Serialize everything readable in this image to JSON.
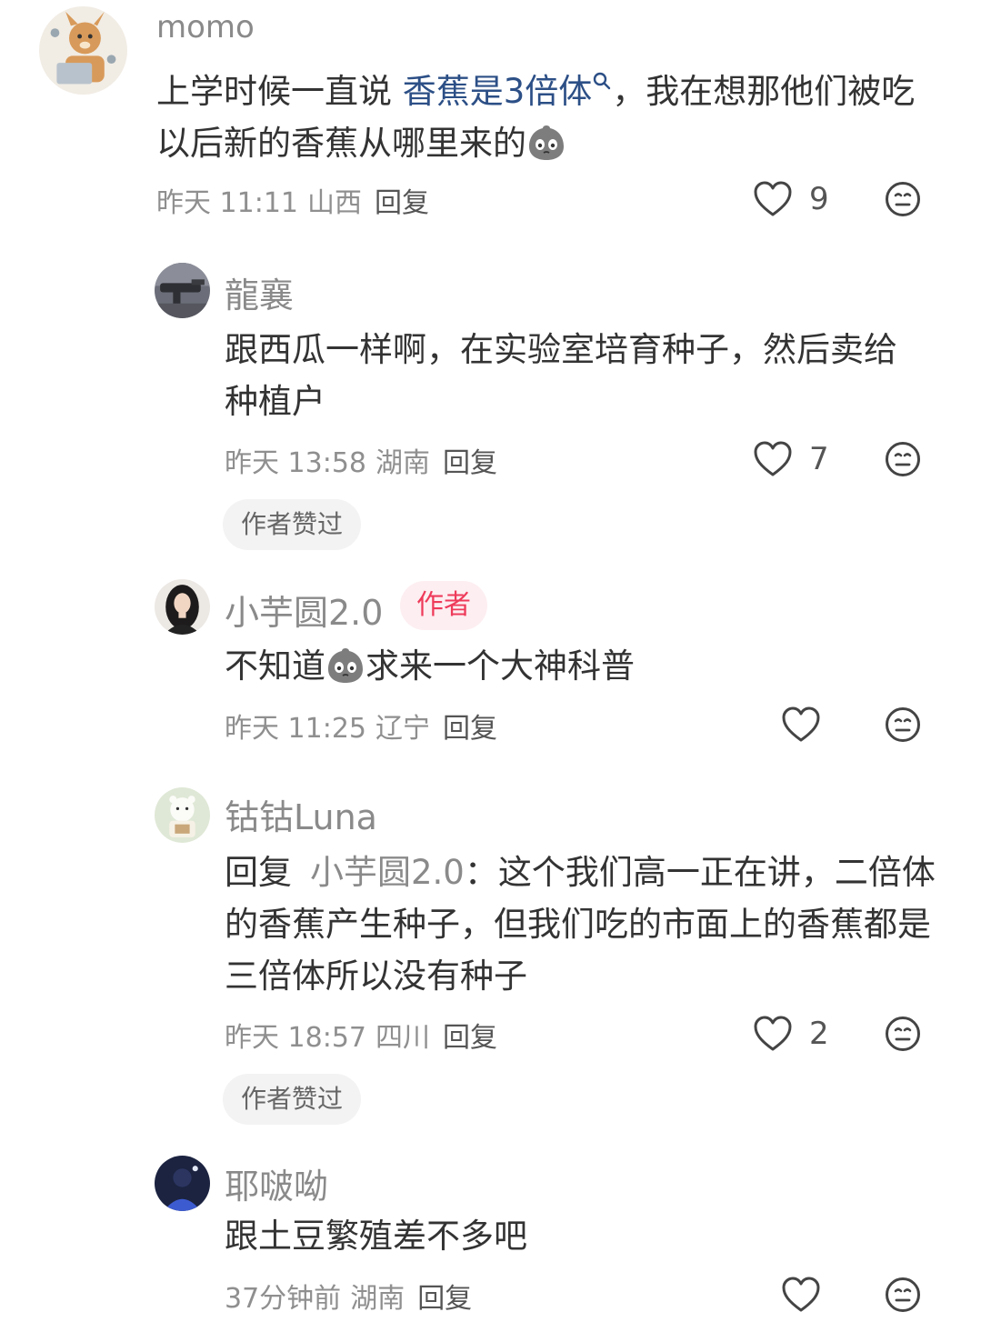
{
  "comments": [
    {
      "author": "momo",
      "text_before": "上学时候一直说 ",
      "link_text": "香蕉是3倍体",
      "text_after": "，我在想那他们被吃以后新的香蕉从哪里来的",
      "emoji": "crying-face-emoji",
      "time": "昨天 11:11",
      "location": "山西",
      "reply_label": "回复",
      "likes": "9"
    },
    {
      "author": "龍襄",
      "text": "跟西瓜一样啊，在实验室培育种子，然后卖给种植户",
      "time": "昨天 13:58",
      "location": "湖南",
      "reply_label": "回复",
      "likes": "7",
      "chip": "作者赞过"
    },
    {
      "author": "小芋圆2.0",
      "badge": "作者",
      "text_before": "不知道",
      "emoji": "crying-face-emoji",
      "text_after": "求来一个大神科普",
      "time": "昨天 11:25",
      "location": "辽宁",
      "reply_label": "回复"
    },
    {
      "author": "钴钴Luna",
      "reply_prefix": "回复",
      "reply_target": "小芋圆2.0",
      "text_colon": "：",
      "text": "这个我们高一正在讲，二倍体的香蕉产生种子，但我们吃的市面上的香蕉都是三倍体所以没有种子",
      "time": "昨天 18:57",
      "location": "四川",
      "reply_label": "回复",
      "likes": "2",
      "chip": "作者赞过"
    },
    {
      "author": "耶啵呦",
      "text": "跟土豆繁殖差不多吧",
      "time": "37分钟前",
      "location": "湖南",
      "reply_label": "回复"
    }
  ],
  "icons": {
    "like": "heart-outline-icon",
    "dislike": "meh-face-icon",
    "search": "search-icon"
  },
  "colors": {
    "link": "#2c4f86",
    "author_badge_text": "#ee3b5a",
    "author_badge_bg": "#fdeef1",
    "meta": "#8f8f8f"
  }
}
